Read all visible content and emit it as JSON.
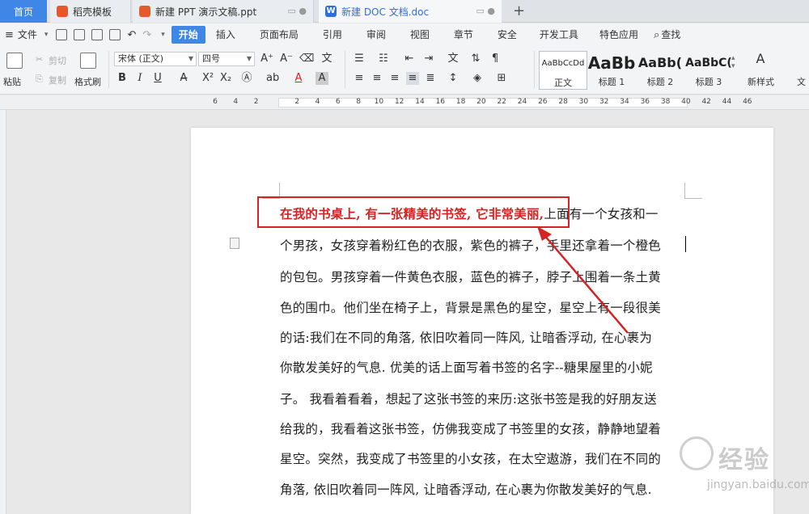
{
  "tabs": {
    "home": "首页",
    "t1": "稻壳模板",
    "t2": "新建 PPT 演示文稿.ppt",
    "t3": "新建 DOC 文档.doc",
    "new_tab": "+"
  },
  "menu": {
    "file": "文件",
    "items": [
      "开始",
      "插入",
      "页面布局",
      "引用",
      "审阅",
      "视图",
      "章节",
      "安全",
      "开发工具",
      "特色应用"
    ],
    "search": "查找"
  },
  "ribbon": {
    "paste": "粘贴",
    "cut": "剪切",
    "copy": "复制",
    "format_painter": "格式刷",
    "font_name": "宋体 (正文)",
    "font_size": "四号",
    "bold": "B",
    "italic": "I",
    "underline": "U",
    "styles": [
      {
        "sample": "AaBbCcDd",
        "name": "正文"
      },
      {
        "sample": "AaBb",
        "name": "标题 1"
      },
      {
        "sample": "AaBb(",
        "name": "标题 2"
      },
      {
        "sample": "AaBbC(",
        "name": "标题 3"
      }
    ],
    "new_style": "新样式",
    "text_tools": "文"
  },
  "ruler": {
    "ticks": [
      "6",
      "4",
      "2",
      "",
      "2",
      "4",
      "6",
      "8",
      "10",
      "12",
      "14",
      "16",
      "18",
      "20",
      "22",
      "24",
      "26",
      "28",
      "30",
      "32",
      "34",
      "36",
      "38",
      "40",
      "42",
      "44",
      "46"
    ]
  },
  "document": {
    "highlighted": "在我的书桌上, 有一张精美的书签, 它非常美丽,",
    "lines": [
      "上面有一个女孩和一",
      "个男孩，女孩穿着粉红色的衣服，紫色的裤子，手里还拿着一个橙色",
      "的包包。男孩穿着一件黄色衣服，蓝色的裤子，脖子上围着一条土黄",
      "色的围巾。他们坐在椅子上，背景是黑色的星空，星空上有一段很美",
      "的话:我们在不同的角落, 依旧吹着同一阵风, 让暗香浮动, 在心裹为",
      "你散发美好的气息. 优美的话上面写着书签的名字--糖果屋里的小妮",
      "子。 我看着看着，想起了这张书签的来历:这张书签是我的好朋友送",
      "给我的，我看着这张书签，仿佛我变成了书签里的女孩，静静地望着",
      "星空。突然，我变成了书签里的小女孩，在太空遨游，我们在不同的",
      "角落, 依旧吹着同一阵风, 让暗香浮动, 在心裹为你散发美好的气息."
    ]
  },
  "watermark": {
    "brand": "经验",
    "url": "jingyan.baidu.com"
  },
  "colors": {
    "accent": "#3f86e6",
    "highlight_red": "#d62222"
  }
}
